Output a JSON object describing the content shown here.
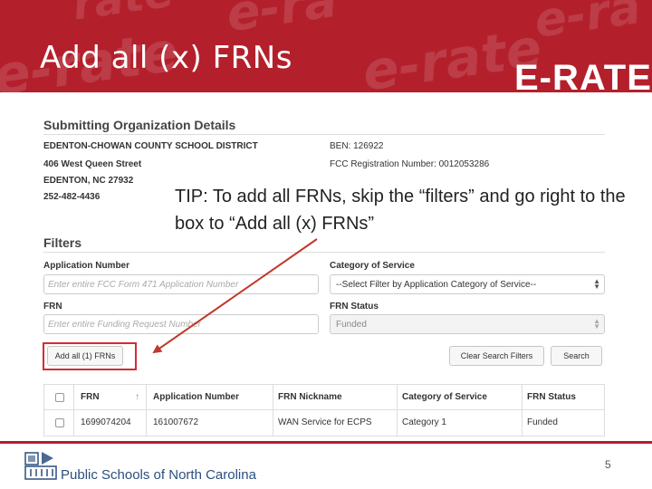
{
  "slide": {
    "title": "Add all (x) FRNs",
    "brand_logo": "E-RATE",
    "page_number": "5"
  },
  "tip": {
    "text": "TIP:  To add all FRNs, skip the “filters” and go right to the box to “Add all (x) FRNs”"
  },
  "org": {
    "section_title": "Submitting Organization Details",
    "name": "EDENTON-CHOWAN COUNTY SCHOOL DISTRICT",
    "street": "406 West Queen Street",
    "city": "EDENTON, NC 27932",
    "phone": "252-482-4436",
    "ben": "BEN: 126922",
    "fcc_reg": "FCC Registration Number: 0012053286"
  },
  "filters": {
    "section_title": "Filters",
    "app_number_label": "Application Number",
    "app_number_placeholder": "Enter entire FCC Form 471 Application Number",
    "category_label": "Category of Service",
    "category_value": "--Select Filter by Application Category of Service--",
    "frn_label": "FRN",
    "frn_placeholder": "Enter entire Funding Request Number",
    "frn_status_label": "FRN Status",
    "frn_status_value": "Funded",
    "add_all_label": "Add all (1) FRNs",
    "clear_label": "Clear Search Filters",
    "search_label": "Search"
  },
  "table": {
    "headers": [
      "FRN",
      "Application Number",
      "FRN Nickname",
      "Category of Service",
      "FRN Status"
    ],
    "sort_indicator": "↑",
    "rows": [
      [
        "1699074204",
        "161007672",
        "WAN Service for ECPS",
        "Category 1",
        "Funded"
      ]
    ]
  },
  "footer": {
    "org_name": "Public Schools of North Carolina"
  },
  "colors": {
    "banner": "#b3202c",
    "highlight": "#d62b35",
    "footer_text": "#2b4f7e"
  }
}
